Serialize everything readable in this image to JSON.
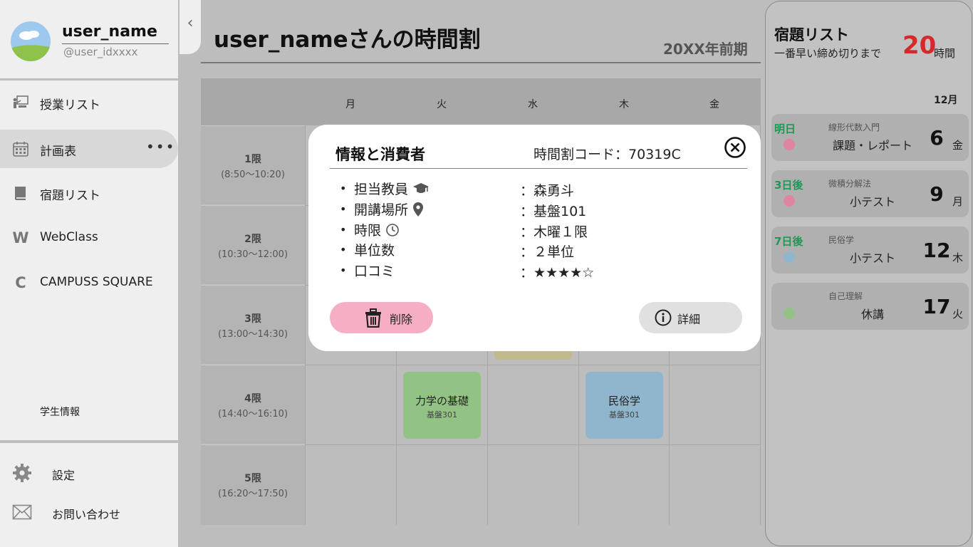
{
  "sidebar": {
    "user_name": "user_name",
    "user_id": "@user_idxxxx",
    "nav": [
      {
        "label": "授業リスト",
        "icon": "lecture-icon"
      },
      {
        "label": "計画表",
        "icon": "calendar-icon",
        "active": true
      },
      {
        "label": "宿題リスト",
        "icon": "book-icon"
      },
      {
        "label": "WebClass",
        "icon": "w-letter-icon"
      },
      {
        "label": "CAMPUSS SQUARE",
        "icon": "c-letter-icon"
      }
    ],
    "more": "•••",
    "student_info": "学生情報",
    "bottom": [
      {
        "label": "設定",
        "icon": "gear-icon"
      },
      {
        "label": "お問い合わせ",
        "icon": "mail-icon"
      }
    ],
    "collapse_icon": "‹"
  },
  "main": {
    "title": "user_nameさんの時間割",
    "semester": "20XX年前期"
  },
  "timetable": {
    "days": [
      "月",
      "火",
      "水",
      "木",
      "金"
    ],
    "periods": [
      {
        "name": "1限",
        "time": "(8:50〜10:20)"
      },
      {
        "name": "2限",
        "time": "(10:30〜12:00)"
      },
      {
        "name": "3限",
        "time": "(13:00〜14:30)"
      },
      {
        "name": "4限",
        "time": "(14:40〜16:10)"
      },
      {
        "name": "5限",
        "time": "(16:20〜17:50)"
      }
    ],
    "classes": [
      {
        "name": "力学の基礎",
        "room": "基盤301",
        "color": "#93c384"
      },
      {
        "name": "民俗学",
        "room": "基盤301",
        "color": "#8fb6cd"
      }
    ]
  },
  "modal": {
    "title": "情報と消費者",
    "code": "時間割コード：70319C",
    "rows": [
      {
        "label": "担当教員",
        "value": "：森勇斗"
      },
      {
        "label": "開講場所",
        "value": "：基盤101"
      },
      {
        "label": "時限",
        "value": "：木曜１限"
      },
      {
        "label": "単位数",
        "value": "：２単位"
      },
      {
        "label": "口コミ",
        "value": "：★★★★☆"
      }
    ],
    "delete_label": "削除",
    "detail_label": "詳細",
    "colors": {
      "delete": "#f6aec4",
      "detail": "#e0e0e0"
    }
  },
  "homework": {
    "title": "宿題リスト",
    "subtitle": "一番早い締め切りまで",
    "hours": "20",
    "hours_unit": "時間",
    "month": "12月",
    "items": [
      {
        "when": "明日",
        "subject": "線形代数入門",
        "task": "課題・レポート",
        "day": "6",
        "weekday": "金",
        "dot_color": "#e0849f"
      },
      {
        "when": "3日後",
        "subject": "微積分解法",
        "task": "小テスト",
        "day": "9",
        "weekday": "月",
        "dot_color": "#e0849f"
      },
      {
        "when": "7日後",
        "subject": "民俗学",
        "task": "小テスト",
        "day": "12",
        "weekday": "木",
        "dot_color": "#8fb6cd"
      },
      {
        "when": "",
        "subject": "自己理解",
        "task": "休講",
        "day": "17",
        "weekday": "火",
        "dot_color": "#93c384"
      }
    ]
  }
}
